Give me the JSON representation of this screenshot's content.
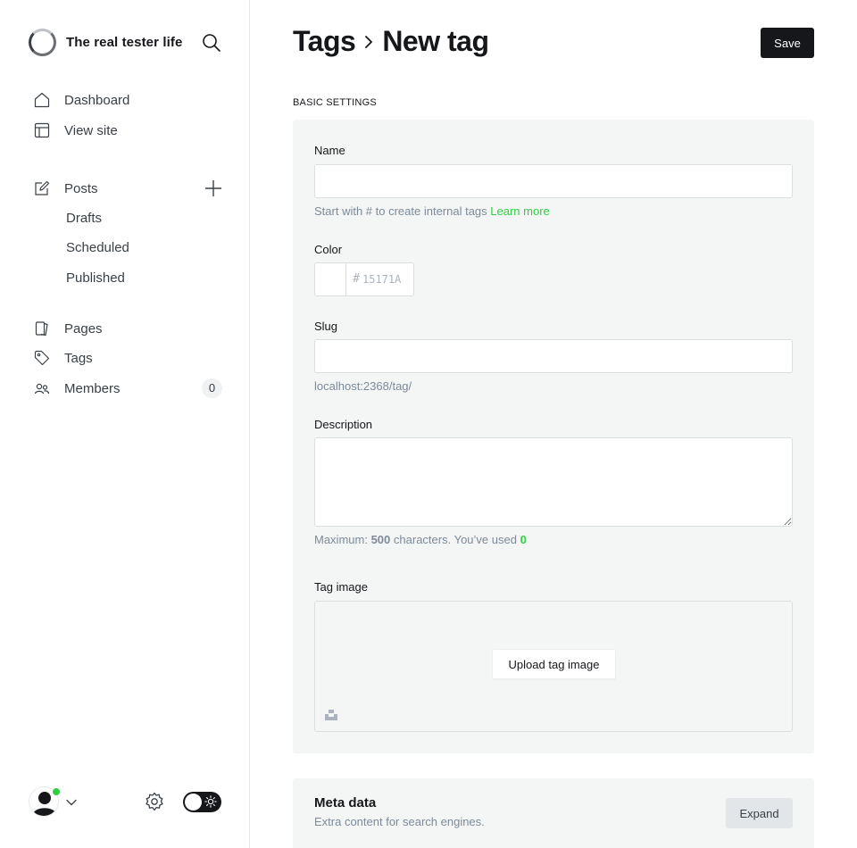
{
  "sidebar": {
    "site_title": "The real tester life",
    "brand_logo_icon": "spinner-ring-logo",
    "search_icon": "search-icon",
    "nav": {
      "dashboard": "Dashboard",
      "view_site": "View site",
      "posts": "Posts",
      "drafts": "Drafts",
      "scheduled": "Scheduled",
      "published": "Published",
      "pages": "Pages",
      "tags": "Tags",
      "members": "Members",
      "members_count": "0"
    },
    "footer": {
      "online_status_color": "#30cf43",
      "theme": "light"
    }
  },
  "header": {
    "breadcrumb_parent": "Tags",
    "breadcrumb_current": "New tag",
    "save_label": "Save"
  },
  "basic_settings": {
    "section_title": "BASIC SETTINGS",
    "name": {
      "label": "Name",
      "value": "",
      "hint_prefix": "Start with # to create internal tags",
      "hint_link": "Learn more"
    },
    "color": {
      "label": "Color",
      "hash": "#",
      "placeholder": "15171A",
      "value": ""
    },
    "slug": {
      "label": "Slug",
      "value": "",
      "url_preview": "localhost:2368/tag/"
    },
    "description": {
      "label": "Description",
      "value": "",
      "hint_prefix": "Maximum:",
      "hint_max": "500",
      "hint_middle": "characters. You’ve used",
      "hint_used": "0"
    },
    "tag_image": {
      "label": "Tag image",
      "upload_label": "Upload tag image"
    }
  },
  "meta_data": {
    "title": "Meta data",
    "subtitle": "Extra content for search engines.",
    "expand_label": "Expand"
  },
  "colors": {
    "accent_green": "#30cf43",
    "primary_dark": "#15171a",
    "panel_bg": "#f4f5f5"
  }
}
